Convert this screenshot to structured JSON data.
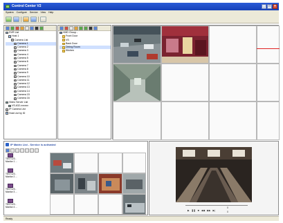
{
  "window": {
    "title": "Control Center V2"
  },
  "menu": [
    "System",
    "Configure",
    "Service",
    "View",
    "Help"
  ],
  "camera_tree": {
    "items": [
      {
        "label": "DVR List",
        "depth": 0,
        "icon": "pc-icon"
      },
      {
        "label": "Host 1",
        "depth": 1,
        "icon": "pc-icon"
      },
      {
        "label": "Camera List",
        "depth": 2,
        "icon": "camera-icon"
      },
      {
        "label": "Camera 1",
        "depth": 3,
        "icon": "camera-icon",
        "selected": true
      },
      {
        "label": "Camera 2",
        "depth": 3,
        "icon": "camera-icon"
      },
      {
        "label": "Camera 3",
        "depth": 3,
        "icon": "camera-icon"
      },
      {
        "label": "Camera 4",
        "depth": 3,
        "icon": "camera-icon"
      },
      {
        "label": "Camera 5",
        "depth": 3,
        "icon": "camera-icon"
      },
      {
        "label": "Camera 6",
        "depth": 3,
        "icon": "camera-icon"
      },
      {
        "label": "Camera 7",
        "depth": 3,
        "icon": "camera-icon"
      },
      {
        "label": "Camera 8",
        "depth": 3,
        "icon": "camera-icon"
      },
      {
        "label": "Camera 9",
        "depth": 3,
        "icon": "camera-icon"
      },
      {
        "label": "Camera 10",
        "depth": 3,
        "icon": "camera-icon"
      },
      {
        "label": "Camera 11",
        "depth": 3,
        "icon": "camera-icon"
      },
      {
        "label": "Camera 12",
        "depth": 3,
        "icon": "camera-icon"
      },
      {
        "label": "Camera 13",
        "depth": 3,
        "icon": "camera-icon"
      },
      {
        "label": "Camera 14",
        "depth": 3,
        "icon": "camera-icon"
      },
      {
        "label": "Camera 15",
        "depth": 3,
        "icon": "camera-icon"
      },
      {
        "label": "Camera 16",
        "depth": 3,
        "icon": "camera-icon"
      },
      {
        "label": "Video Server List",
        "depth": 0,
        "icon": "server-icon"
      },
      {
        "label": "VS-632-xxxxxx",
        "depth": 1,
        "icon": "server-icon"
      },
      {
        "label": "IP Camera List",
        "depth": 0,
        "icon": "camera-icon"
      },
      {
        "label": "Host List by ID",
        "depth": 0,
        "icon": "pc-icon"
      }
    ]
  },
  "group_tree": {
    "items": [
      {
        "label": "VMD Group -",
        "depth": 0,
        "icon": "group-icon"
      },
      {
        "label": "Front Door",
        "depth": 1,
        "icon": "folder-icon"
      },
      {
        "label": "VS",
        "depth": 1,
        "icon": "folder-icon"
      },
      {
        "label": "Back Door",
        "depth": 1,
        "icon": "folder-icon"
      },
      {
        "label": "Dining Room",
        "depth": 1,
        "icon": "folder-icon",
        "selected": true
      },
      {
        "label": "Kitchen",
        "depth": 1,
        "icon": "folder-icon"
      }
    ]
  },
  "ip_matrix": {
    "header": "IP Matrix List - Service is activated",
    "monitors": [
      {
        "line1": "TEST123 -",
        "line2": "Monitor 1 ..."
      },
      {
        "line1": "TEST123 -",
        "line2": "Monitor 2 ..."
      },
      {
        "line1": "TEST123 -",
        "line2": "Monitor 3 ..."
      },
      {
        "line1": "TEST123 -",
        "line2": "Monitor 4 ..."
      }
    ]
  },
  "player": {
    "time_left": "0",
    "time_right": "0"
  },
  "status": {
    "text": "Ready"
  },
  "colors": {
    "title_blue": "#1c4fc8",
    "accent_red": "#e02020",
    "chrome": "#ece9d8"
  }
}
